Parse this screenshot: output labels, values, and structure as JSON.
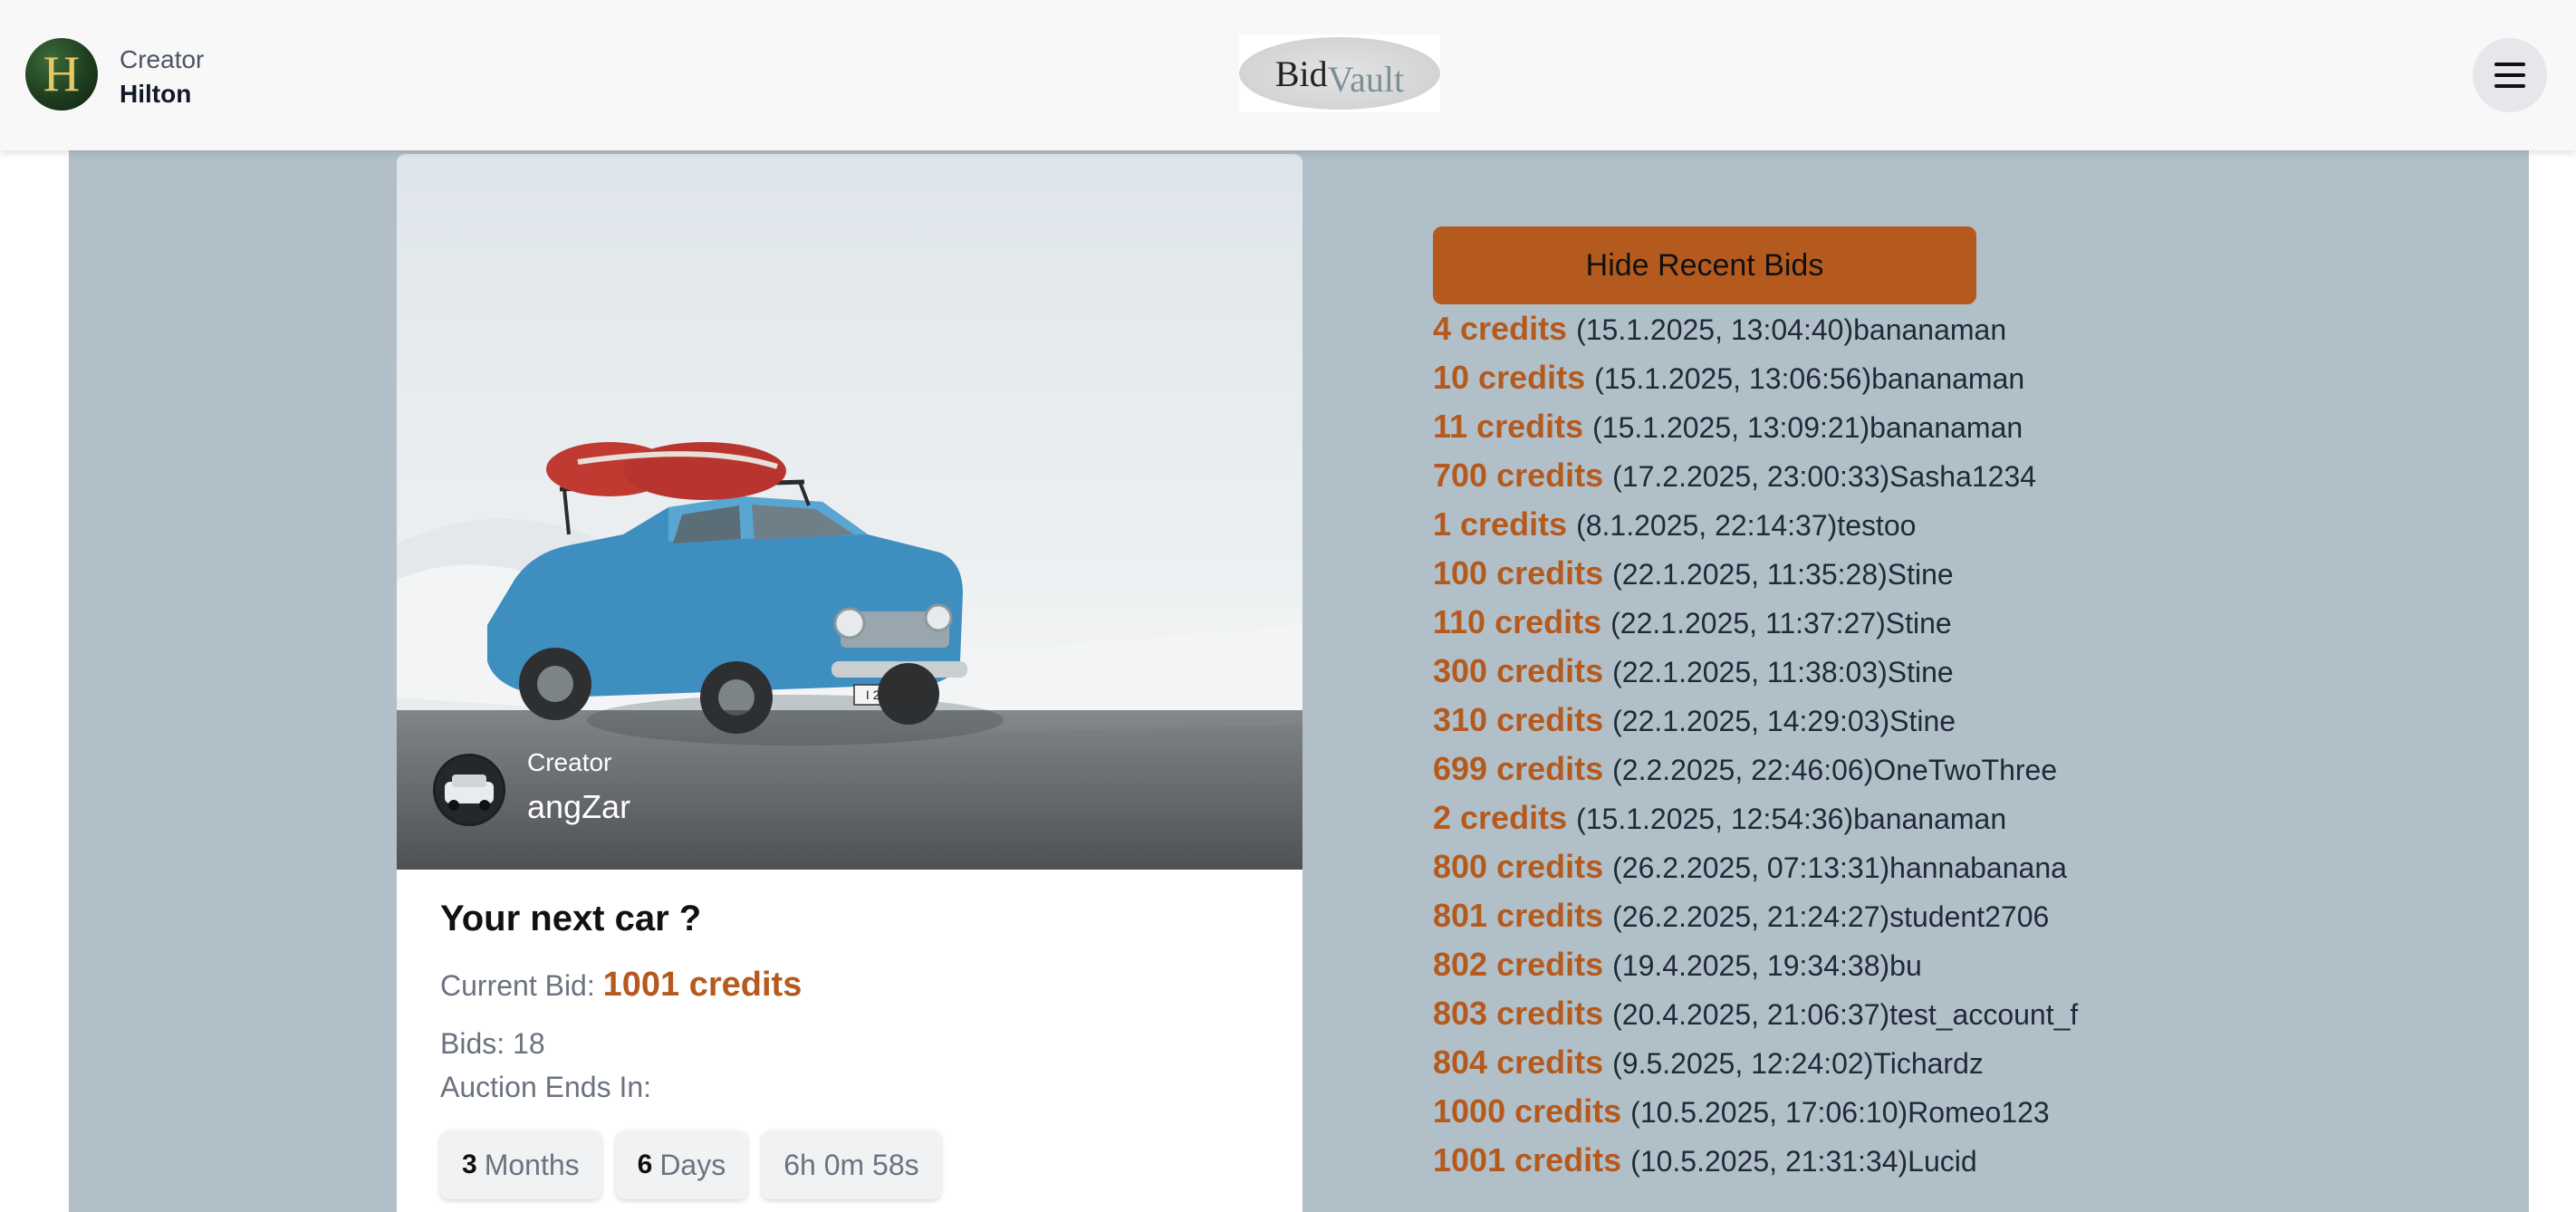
{
  "header": {
    "user_initial": "H",
    "user_role": "Creator",
    "user_name": "Hilton",
    "logo_bid": "Bid",
    "logo_vault": "Vault",
    "menu_icon": "hamburger-icon"
  },
  "card": {
    "image_alt": "Blue vintage car with roof rack in snow",
    "plate_text": "I 2430 B",
    "creator_label": "Creator",
    "creator_name": "angZar",
    "title": "Your next car ?",
    "current_bid_label": "Current Bid:",
    "current_bid_value": "1001 credits",
    "bids_count": "Bids: 18",
    "auction_ends_label": "Auction Ends In:",
    "countdown": {
      "months_num": "3",
      "months_label": "Months",
      "days_num": "6",
      "days_label": "Days",
      "time": "6h 0m 58s"
    }
  },
  "bids_panel": {
    "toggle_label": "Hide Recent Bids",
    "bids": [
      {
        "amount": "4 credits",
        "meta": "(15.1.2025, 13:04:40)bananaman"
      },
      {
        "amount": "10 credits",
        "meta": "(15.1.2025, 13:06:56)bananaman"
      },
      {
        "amount": "11 credits",
        "meta": "(15.1.2025, 13:09:21)bananaman"
      },
      {
        "amount": "700 credits",
        "meta": "(17.2.2025, 23:00:33)Sasha1234"
      },
      {
        "amount": "1 credits",
        "meta": "(8.1.2025, 22:14:37)testoo"
      },
      {
        "amount": "100 credits",
        "meta": "(22.1.2025, 11:35:28)Stine"
      },
      {
        "amount": "110 credits",
        "meta": "(22.1.2025, 11:37:27)Stine"
      },
      {
        "amount": "300 credits",
        "meta": "(22.1.2025, 11:38:03)Stine"
      },
      {
        "amount": "310 credits",
        "meta": "(22.1.2025, 14:29:03)Stine"
      },
      {
        "amount": "699 credits",
        "meta": "(2.2.2025, 22:46:06)OneTwoThree"
      },
      {
        "amount": "2 credits",
        "meta": "(15.1.2025, 12:54:36)bananaman"
      },
      {
        "amount": "800 credits",
        "meta": "(26.2.2025, 07:13:31)hannabanana"
      },
      {
        "amount": "801 credits",
        "meta": "(26.2.2025, 21:24:27)student2706"
      },
      {
        "amount": "802 credits",
        "meta": "(19.4.2025, 19:34:38)bu"
      },
      {
        "amount": "803 credits",
        "meta": "(20.4.2025, 21:06:37)test_account_f"
      },
      {
        "amount": "804 credits",
        "meta": "(9.5.2025, 12:24:02)Tichardz"
      },
      {
        "amount": "1000 credits",
        "meta": "(10.5.2025, 17:06:10)Romeo123"
      },
      {
        "amount": "1001 credits",
        "meta": "(10.5.2025, 21:31:34)Lucid"
      }
    ]
  },
  "colors": {
    "accent": "#b55a1e",
    "page_bg": "#b1c0c8",
    "header_bg": "#f8f8f8"
  }
}
